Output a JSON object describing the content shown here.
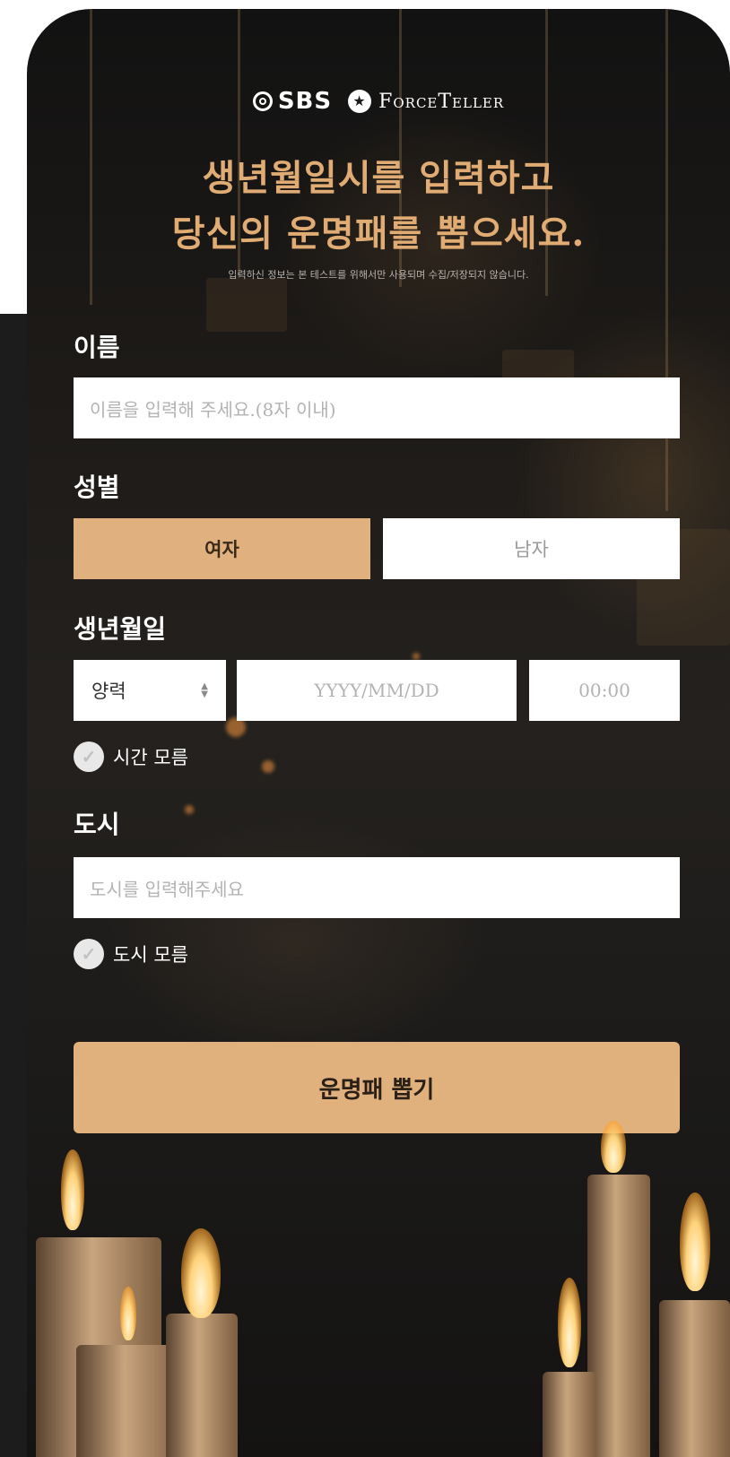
{
  "logos": {
    "sbs": "SBS",
    "forceteller": "ForceTeller"
  },
  "headline": {
    "line1": "생년월일시를 입력하고",
    "line2": "당신의 운명패를 뽑으세요."
  },
  "notice": "입력하신 정보는 본 테스트를 위해서만 사용되며 수집/저장되지 않습니다.",
  "form": {
    "name": {
      "label": "이름",
      "placeholder": "이름을 입력해 주세요.(8자 이내)"
    },
    "gender": {
      "label": "성별",
      "options": [
        "여자",
        "남자"
      ],
      "selected": "여자"
    },
    "birth": {
      "label": "생년월일",
      "calendar_value": "양력",
      "date_placeholder": "YYYY/MM/DD",
      "time_placeholder": "00:00",
      "unknown_time_label": "시간 모름"
    },
    "city": {
      "label": "도시",
      "placeholder": "도시를 입력해주세요",
      "unknown_city_label": "도시 모름"
    },
    "submit_label": "운명패 뽑기"
  },
  "colors": {
    "accent": "#e0b17e",
    "headline": "#e0ac74",
    "background": "#1d1a17"
  }
}
